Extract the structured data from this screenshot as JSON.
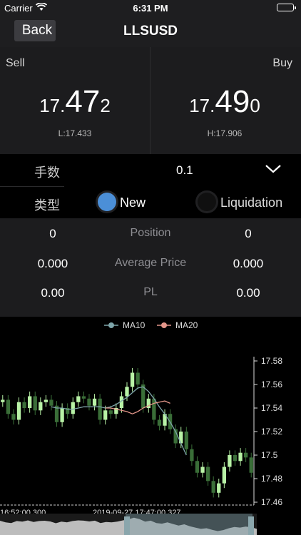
{
  "status_bar": {
    "carrier": "Carrier",
    "time": "6:31 PM"
  },
  "nav": {
    "back_label": "Back",
    "title": "LLSUSD"
  },
  "quote": {
    "sell_label": "Sell",
    "buy_label": "Buy",
    "sell_price": {
      "prefix": "17.",
      "main": "47",
      "suffix": "2"
    },
    "buy_price": {
      "prefix": "17.",
      "main": "49",
      "suffix": "0"
    },
    "low": "L:17.433",
    "high": "H:17.906"
  },
  "order": {
    "lots_label": "手数",
    "lots_value": "0.1",
    "type_label": "类型",
    "options": [
      "New",
      "Liquidation"
    ],
    "selected": "New"
  },
  "position": {
    "rows": [
      {
        "left": "0",
        "label": "Position",
        "right": "0"
      },
      {
        "left": "0.000",
        "label": "Average Price",
        "right": "0.000"
      },
      {
        "left": "0.00",
        "label": "PL",
        "right": "0.00"
      }
    ]
  },
  "colors": {
    "up": "#b8f2a6",
    "down": "#3a6e38",
    "ma10": "#7fa6ab",
    "ma20": "#e3968a",
    "radio_selected": "#4b8fd8"
  },
  "chart_data": {
    "type": "line",
    "legend": [
      "MA10",
      "MA20"
    ],
    "legend_placement": "top",
    "y_ticks": [
      "17.58",
      "17.56",
      "17.54",
      "17.52",
      "17.5",
      "17.48",
      "17.46"
    ],
    "ylim": [
      17.46,
      17.58
    ],
    "x_labels": [
      "16:52:00.300",
      "2019-09-27 17:47:00.327"
    ],
    "series": [
      {
        "name": "price",
        "values": [
          17.547,
          17.535,
          17.53,
          17.545,
          17.54,
          17.55,
          17.538,
          17.545,
          17.547,
          17.542,
          17.528,
          17.54,
          17.535,
          17.545,
          17.55,
          17.548,
          17.542,
          17.548,
          17.53,
          17.538,
          17.535,
          17.54,
          17.55,
          17.558,
          17.57,
          17.56,
          17.54,
          17.548,
          17.53,
          17.525,
          17.535,
          17.522,
          17.51,
          17.52,
          17.505,
          17.495,
          17.485,
          17.49,
          17.478,
          17.468,
          17.476,
          17.49,
          17.5,
          17.495,
          17.502,
          17.498,
          17.485
        ]
      },
      {
        "name": "MA10",
        "values": [
          null,
          null,
          null,
          null,
          null,
          null,
          null,
          null,
          null,
          17.541,
          17.54,
          17.54,
          17.539,
          17.539,
          17.54,
          17.541,
          17.541,
          17.541,
          17.541,
          17.54,
          17.541,
          17.543,
          17.546,
          17.549,
          17.553,
          17.557,
          17.558,
          17.554,
          17.548,
          17.541,
          17.535,
          17.528,
          17.52,
          17.51,
          17.5
        ]
      },
      {
        "name": "MA20",
        "values": [
          null,
          null,
          null,
          null,
          null,
          null,
          null,
          null,
          null,
          null,
          null,
          null,
          null,
          null,
          null,
          null,
          null,
          null,
          null,
          17.54,
          17.54,
          17.539,
          17.538,
          17.537,
          17.535,
          17.537,
          17.54,
          17.542,
          17.544,
          17.545,
          17.546,
          17.544
        ]
      }
    ]
  }
}
